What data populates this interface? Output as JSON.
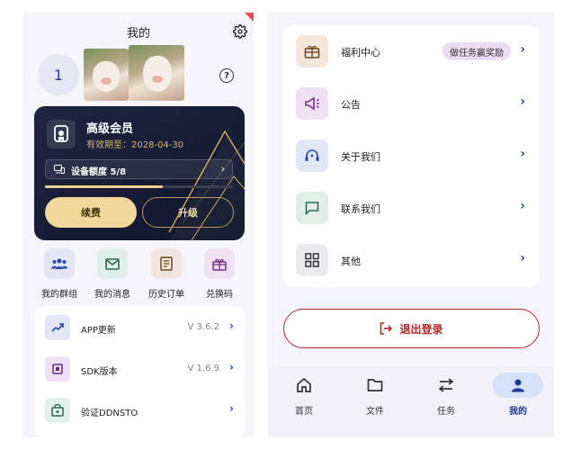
{
  "profile": {
    "title": "我的",
    "avatar_initial": "1"
  },
  "vip_card": {
    "title": "高级会员",
    "expiry": "有效期至：2028-04-30",
    "quota_label": "设备额度 5/8",
    "quota_fraction": 0.625,
    "renew_label": "续费",
    "upgrade_label": "升级"
  },
  "quick_actions": [
    {
      "label": "我的群组",
      "icon": "group-icon",
      "bg": "#e3e6f7"
    },
    {
      "label": "我的消息",
      "icon": "mail-icon",
      "bg": "#e1f0ea"
    },
    {
      "label": "历史订单",
      "icon": "receipt-icon",
      "bg": "#f3e6e1"
    },
    {
      "label": "兑换码",
      "icon": "gift-icon",
      "bg": "#f0e1f3"
    }
  ],
  "info_list": [
    {
      "label": "APP更新",
      "value": "V 3.6.2",
      "icon": "trending-up-icon",
      "bg": "#e3e6f7"
    },
    {
      "label": "SDK版本",
      "value": "V 1.6.9",
      "icon": "chip-icon",
      "bg": "#efe1f4"
    },
    {
      "label": "验证DDNSTO",
      "value": "",
      "icon": "verify-icon",
      "bg": "#e1f0ea"
    }
  ],
  "menu": [
    {
      "label": "福利中心",
      "badge": "做任务赢奖励",
      "icon": "gift-box-icon",
      "bg": "#f3e7dc"
    },
    {
      "label": "公告",
      "badge": "",
      "icon": "megaphone-icon",
      "bg": "#f0e1f4"
    },
    {
      "label": "关于我们",
      "badge": "",
      "icon": "support-icon",
      "bg": "#e2e7f6"
    },
    {
      "label": "联系我们",
      "badge": "",
      "icon": "chat-icon",
      "bg": "#e1efe9"
    },
    {
      "label": "其他",
      "badge": "",
      "icon": "grid-icon",
      "bg": "#ebebee"
    }
  ],
  "logout_label": "退出登录",
  "tabs": [
    {
      "label": "首页",
      "icon": "home-icon",
      "active": false
    },
    {
      "label": "文件",
      "icon": "folder-icon",
      "active": false
    },
    {
      "label": "任务",
      "icon": "transfer-icon",
      "active": false
    },
    {
      "label": "我的",
      "icon": "person-icon",
      "active": true
    }
  ],
  "colors": {
    "accent": "#2748b8",
    "gold": "#f1d79a",
    "danger": "#b8252a",
    "card_dark": "#1a1f38"
  }
}
